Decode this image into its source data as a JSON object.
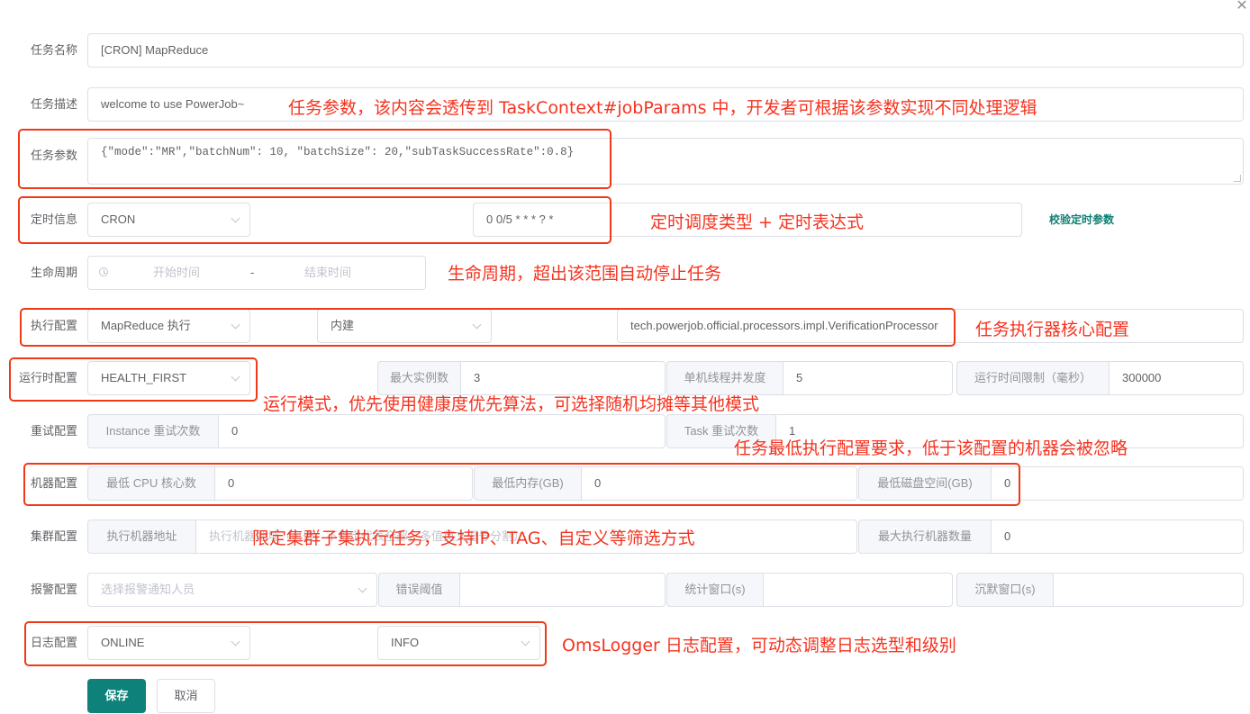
{
  "dialog": {
    "close_icon": "close-icon"
  },
  "form": {
    "name": {
      "label": "任务名称",
      "value": "[CRON] MapReduce"
    },
    "description": {
      "label": "任务描述",
      "value": "welcome to use PowerJob~"
    },
    "params": {
      "label": "任务参数",
      "value": "{\"mode\":\"MR\",\"batchNum\": 10, \"batchSize\": 20,\"subTaskSuccessRate\":0.8}"
    },
    "schedule": {
      "label": "定时信息",
      "type": "CRON",
      "expression": "0 0/5 * * * ? *",
      "validate_link": "校验定时参数"
    },
    "lifecycle": {
      "label": "生命周期",
      "start_placeholder": "开始时间",
      "separator": "-",
      "end_placeholder": "结束时间"
    },
    "execution": {
      "label": "执行配置",
      "exec_type": "MapReduce 执行",
      "processor_type": "内建",
      "processor": "tech.powerjob.official.processors.impl.VerificationProcessor"
    },
    "runtime": {
      "label": "运行时配置",
      "dispatch_strategy": "HEALTH_FIRST",
      "max_instances_label": "最大实例数",
      "max_instances": "3",
      "concurrency_label": "单机线程并发度",
      "concurrency": "5",
      "time_limit_label": "运行时间限制（毫秒）",
      "time_limit": "300000"
    },
    "retry": {
      "label": "重试配置",
      "instance_retry_label": "Instance 重试次数",
      "instance_retry": "0",
      "task_retry_label": "Task 重试次数",
      "task_retry": "1"
    },
    "machine": {
      "label": "机器配置",
      "cpu_label": "最低 CPU 核心数",
      "cpu": "0",
      "memory_label": "最低内存(GB)",
      "memory": "0",
      "disk_label": "最低磁盘空间(GB)",
      "disk": "0"
    },
    "cluster": {
      "label": "集群配置",
      "address_label": "执行机器地址",
      "address_placeholder": "执行机器地址（可选，不指定代表全部；多值英文逗号分割）",
      "max_workers_label": "最大执行机器数量",
      "max_workers": "0"
    },
    "alarm": {
      "label": "报警配置",
      "receivers_placeholder": "选择报警通知人员",
      "threshold_label": "错误阈值",
      "threshold": "",
      "stat_window_label": "统计窗口(s)",
      "stat_window": "",
      "silence_window_label": "沉默窗口(s)",
      "silence_window": ""
    },
    "log": {
      "label": "日志配置",
      "type": "ONLINE",
      "level": "INFO"
    },
    "buttons": {
      "save": "保存",
      "cancel": "取消"
    }
  },
  "annotations": {
    "params": "任务参数，该内容会透传到 TaskContext#jobParams 中，开发者可根据该参数实现不同处理逻辑",
    "schedule": "定时调度类型 + 定时表达式",
    "lifecycle": "生命周期，超出该范围自动停止任务",
    "execution": "任务执行器核心配置",
    "runtime": "运行模式，优先使用健康度优先算法，可选择随机均摊等其他模式",
    "machine": "任务最低执行配置要求，低于该配置的机器会被忽略",
    "cluster": "限定集群子集执行任务，支持IP、TAG、自定义等筛选方式",
    "log": "OmsLogger 日志配置，可动态调整日志选型和级别"
  },
  "colors": {
    "primary": "#0e827a",
    "annotation": "#f5331f",
    "highlight_box": "#f03a17"
  }
}
